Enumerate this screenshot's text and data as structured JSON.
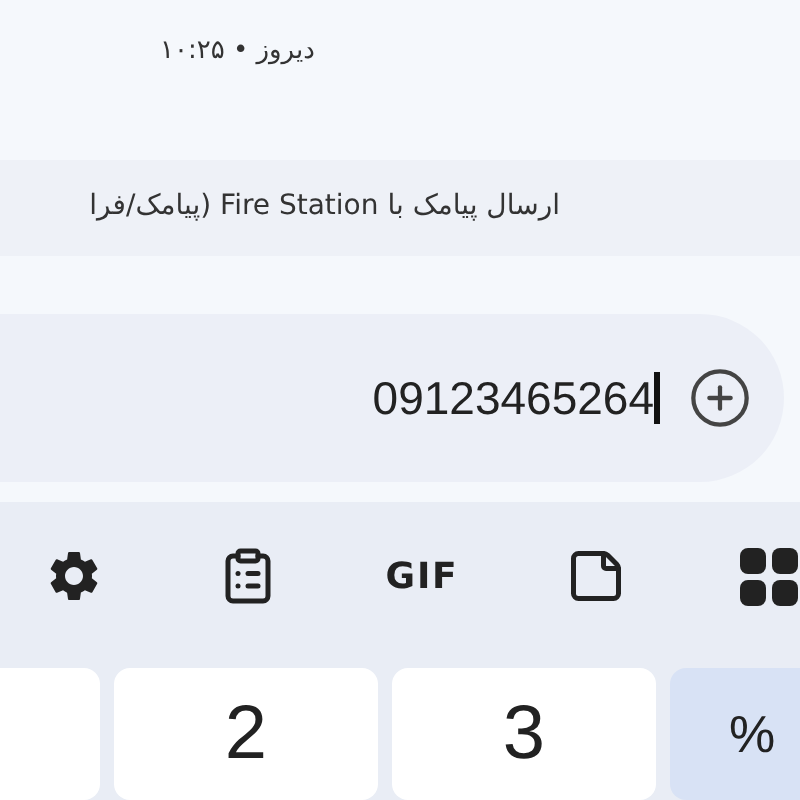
{
  "timestamp": "دیروز • ۱۰:۲۵",
  "banner": "ارسال پیامک با Fire Station (پیامک/فرا",
  "compose": {
    "value": "09123465264"
  },
  "toolbar": [
    {
      "kind": "settings"
    },
    {
      "kind": "clipboard"
    },
    {
      "kind": "gif",
      "label": "GIF"
    },
    {
      "kind": "sticker"
    },
    {
      "kind": "grid"
    }
  ],
  "keys": [
    {
      "label": "%",
      "kind": "symbol"
    },
    {
      "label": "3",
      "kind": "digit"
    },
    {
      "label": "2",
      "kind": "digit"
    }
  ]
}
